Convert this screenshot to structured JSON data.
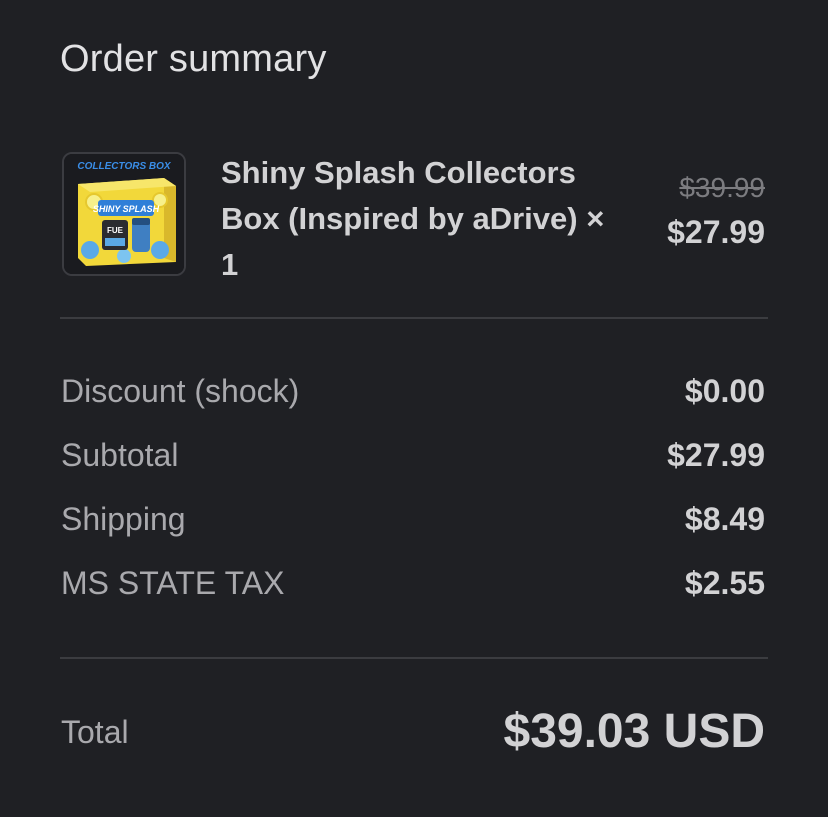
{
  "summary": {
    "title": "Order summary"
  },
  "item": {
    "name": "Shiny Splash Collectors Box (Inspired by aDrive) × 1",
    "original_price": "$39.99",
    "price": "$27.99",
    "thumbnail": {
      "banner_text": "COLLECTORS BOX",
      "product_text": "SHINY SPLASH",
      "brand_text": "FUE"
    }
  },
  "lines": [
    {
      "label": "Discount (shock)",
      "value": "$0.00"
    },
    {
      "label": "Subtotal",
      "value": "$27.99"
    },
    {
      "label": "Shipping",
      "value": "$8.49"
    },
    {
      "label": "MS STATE TAX",
      "value": "$2.55"
    }
  ],
  "total": {
    "label": "Total",
    "value": "$39.03 USD"
  },
  "colors": {
    "background": "#1f2024",
    "divider": "#3b3c40",
    "text_primary": "#d2d2d4",
    "text_secondary": "#a9a9ad"
  }
}
